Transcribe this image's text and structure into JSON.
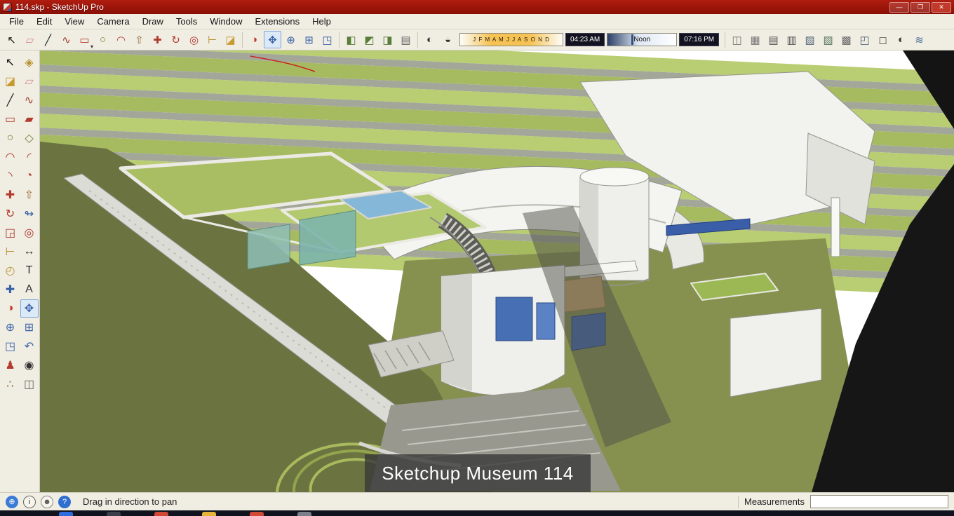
{
  "window": {
    "title": "114.skp - SketchUp Pro",
    "controls": [
      {
        "name": "minimize-button",
        "glyph": "—",
        "style": "background:rgba(255,255,255,.14)"
      },
      {
        "name": "maximize-button",
        "glyph": "❐",
        "style": "background:rgba(255,255,255,.14)"
      },
      {
        "name": "close-button",
        "glyph": "✕",
        "style": "background:#c0392b"
      }
    ]
  },
  "menu": {
    "items": [
      "File",
      "Edit",
      "View",
      "Camera",
      "Draw",
      "Tools",
      "Window",
      "Extensions",
      "Help"
    ]
  },
  "toolbar": {
    "draw_tools": [
      {
        "name": "select-tool",
        "glyph": "↖",
        "style": "color:#111"
      },
      {
        "name": "eraser-tool",
        "glyph": "▱",
        "style": "color:#d98c8c"
      },
      {
        "name": "line-tool",
        "glyph": "╱",
        "style": "color:#222"
      },
      {
        "name": "freehand-tool",
        "glyph": "∿",
        "style": "color:#a33b2e"
      },
      {
        "name": "rectangle-tool",
        "glyph": "▭",
        "style": "color:#b23b2e",
        "caret": true
      },
      {
        "name": "circle-tool",
        "glyph": "○",
        "style": "color:#6f7d2e"
      },
      {
        "name": "arc-tool",
        "glyph": "◠",
        "style": "color:#b23b2e"
      },
      {
        "name": "push-pull-tool",
        "glyph": "⇧",
        "style": "color:#9c6b38"
      },
      {
        "name": "move-tool",
        "glyph": "✚",
        "style": "color:#b23b2e"
      },
      {
        "name": "rotate-tool",
        "glyph": "↻",
        "style": "color:#b23b2e"
      },
      {
        "name": "offset-tool",
        "glyph": "◎",
        "style": "color:#b23b2e"
      },
      {
        "name": "tape-measure-tool",
        "glyph": "⊢",
        "style": "color:#b8912f"
      },
      {
        "name": "paint-bucket-tool",
        "glyph": "◪",
        "style": "color:#c79a2e"
      }
    ],
    "camera_tools": [
      {
        "name": "orbit-tool",
        "glyph": "◑",
        "style": "color:#c0392b"
      },
      {
        "name": "pan-tool",
        "glyph": "✥",
        "style": "color:#3a62a8",
        "pressed": true
      },
      {
        "name": "zoom-tool",
        "glyph": "⊕",
        "style": "color:#3a62a8"
      },
      {
        "name": "zoom-window-tool",
        "glyph": "⊞",
        "style": "color:#3a62a8"
      },
      {
        "name": "zoom-extents-tool",
        "glyph": "◳",
        "style": "color:#3a62a8"
      }
    ],
    "view_tools": [
      {
        "name": "iso-view",
        "glyph": "◧",
        "style": "color:#5a7d3a"
      },
      {
        "name": "top-view",
        "glyph": "◩",
        "style": "color:#5a7d3a"
      },
      {
        "name": "front-view",
        "glyph": "◨",
        "style": "color:#5a7d3a"
      },
      {
        "name": "styles-button",
        "glyph": "▤",
        "style": "color:#666"
      }
    ],
    "shadow_toggles": [
      {
        "name": "shadow-settings-button",
        "glyph": "◐",
        "style": "color:#333"
      },
      {
        "name": "shadow-toggle-button",
        "glyph": "◒",
        "style": "color:#333"
      }
    ],
    "shadow": {
      "months": "J F M A M J J A S O N D",
      "start": "04:23 AM",
      "noon": "Noon",
      "end": "07:16 PM"
    },
    "right_tools": [
      {
        "name": "section-plane-button",
        "glyph": "◫",
        "style": "color:#777"
      },
      {
        "name": "section-cuts-button",
        "glyph": "▦",
        "style": "color:#777"
      },
      {
        "name": "wireframe-style",
        "glyph": "▤",
        "style": "color:#555"
      },
      {
        "name": "hidden-line-style",
        "glyph": "▥",
        "style": "color:#555"
      },
      {
        "name": "shaded-style",
        "glyph": "▧",
        "style": "color:#55677a"
      },
      {
        "name": "shaded-textures-style",
        "glyph": "▨",
        "style": "color:#57755a"
      },
      {
        "name": "monochrome-style",
        "glyph": "▩",
        "style": "color:#666"
      },
      {
        "name": "xray-style",
        "glyph": "◰",
        "style": "color:#55677a"
      },
      {
        "name": "scenes-button",
        "glyph": "◻",
        "style": "color:#555"
      },
      {
        "name": "shadows-dialog-button",
        "glyph": "◐",
        "style": "color:#333"
      },
      {
        "name": "fog-button",
        "glyph": "≋",
        "style": "color:#557799"
      }
    ]
  },
  "left_toolbar": {
    "tools": [
      {
        "name": "select-tool",
        "glyph": "↖",
        "style": "color:#111"
      },
      {
        "name": "make-component-tool",
        "glyph": "◈",
        "style": "color:#b8912f"
      },
      {
        "name": "paint-bucket-tool",
        "glyph": "◪",
        "style": "color:#c79a2e"
      },
      {
        "name": "eraser-tool",
        "glyph": "▱",
        "style": "color:#d98c8c"
      },
      {
        "name": "line-tool",
        "glyph": "╱",
        "style": "color:#222"
      },
      {
        "name": "freehand-tool",
        "glyph": "∿",
        "style": "color:#a33b2e"
      },
      {
        "name": "rectangle-tool",
        "glyph": "▭",
        "style": "color:#b23b2e"
      },
      {
        "name": "rotated-rectangle-tool",
        "glyph": "▰",
        "style": "color:#b23b2e"
      },
      {
        "name": "circle-tool",
        "glyph": "○",
        "style": "color:#6f7d2e"
      },
      {
        "name": "polygon-tool",
        "glyph": "◇",
        "style": "color:#6f7d2e"
      },
      {
        "name": "arc-tool",
        "glyph": "◠",
        "style": "color:#b23b2e"
      },
      {
        "name": "two-point-arc-tool",
        "glyph": "◜",
        "style": "color:#b23b2e"
      },
      {
        "name": "three-point-arc-tool",
        "glyph": "◝",
        "style": "color:#b23b2e"
      },
      {
        "name": "pie-tool",
        "glyph": "◔",
        "style": "color:#b23b2e"
      },
      {
        "name": "move-tool",
        "glyph": "✚",
        "style": "color:#b23b2e"
      },
      {
        "name": "push-pull-tool",
        "glyph": "⇧",
        "style": "color:#9c6b38"
      },
      {
        "name": "rotate-tool",
        "glyph": "↻",
        "style": "color:#b23b2e"
      },
      {
        "name": "follow-me-tool",
        "glyph": "↬",
        "style": "color:#3a62a8"
      },
      {
        "name": "scale-tool",
        "glyph": "◲",
        "style": "color:#b23b2e"
      },
      {
        "name": "offset-tool",
        "glyph": "◎",
        "style": "color:#b23b2e"
      },
      {
        "name": "tape-measure-tool",
        "glyph": "⊢",
        "style": "color:#b8912f"
      },
      {
        "name": "dimension-tool",
        "glyph": "↔",
        "style": "color:#333"
      },
      {
        "name": "protractor-tool",
        "glyph": "◴",
        "style": "color:#b8912f"
      },
      {
        "name": "text-tool",
        "glyph": "T",
        "style": "color:#333"
      },
      {
        "name": "axes-tool",
        "glyph": "✚",
        "style": "color:#3a62a8"
      },
      {
        "name": "three-d-text-tool",
        "glyph": "A",
        "style": "color:#333"
      },
      {
        "name": "orbit-tool",
        "glyph": "◑",
        "style": "color:#c0392b"
      },
      {
        "name": "pan-tool",
        "glyph": "✥",
        "style": "color:#3a62a8",
        "pressed": true
      },
      {
        "name": "zoom-tool",
        "glyph": "⊕",
        "style": "color:#3a62a8"
      },
      {
        "name": "zoom-window-tool",
        "glyph": "⊞",
        "style": "color:#3a62a8"
      },
      {
        "name": "zoom-extents-tool",
        "glyph": "◳",
        "style": "color:#3a62a8"
      },
      {
        "name": "previous-view-tool",
        "glyph": "↶",
        "style": "color:#3a62a8"
      },
      {
        "name": "position-camera-tool",
        "glyph": "♟",
        "style": "color:#b23b2e"
      },
      {
        "name": "look-around-tool",
        "glyph": "◉",
        "style": "color:#333"
      },
      {
        "name": "walk-tool",
        "glyph": "∴",
        "style": "color:#8a5a2a"
      },
      {
        "name": "section-plane-tool",
        "glyph": "◫",
        "style": "color:#666"
      }
    ]
  },
  "viewport": {
    "caption": "Sketchup Museum 114"
  },
  "status_bar": {
    "icons": [
      {
        "name": "geolocation-icon",
        "glyph": "⊕",
        "style": "background:#3a7bd5;color:#fff"
      },
      {
        "name": "info-icon",
        "glyph": "i",
        "style": "background:#f7f5ec;color:#333;border:1px solid #666"
      },
      {
        "name": "user-icon",
        "glyph": "☻",
        "style": "background:#f7f5ec;color:#555;border:1px solid #888"
      },
      {
        "name": "help-icon",
        "glyph": "?",
        "style": "background:#2f6fd0;color:#fff"
      }
    ],
    "hint": "Drag in direction to pan",
    "measurements_label": "Measurements",
    "measurements_value": ""
  },
  "taskbar": {
    "apps": [
      {
        "name": "taskbar-app-icon",
        "style": "background:#2d6cdf"
      },
      {
        "name": "taskbar-app-icon",
        "style": "background:#3b3f4a"
      },
      {
        "name": "taskbar-app-icon",
        "style": "background:#d14836"
      },
      {
        "name": "taskbar-app-icon",
        "style": "background:#e8b339"
      },
      {
        "name": "taskbar-app-icon",
        "style": "background:#d14836"
      },
      {
        "name": "taskbar-app-icon",
        "style": "background:#7a7f8a"
      }
    ]
  },
  "theme": {
    "titlebar_red": "#9b1207",
    "toolbar_bg": "#f0ede3",
    "pressed_blue": "#dce9f7",
    "terrain_green": "#b9cd72",
    "terrain_olive": "#6b7440",
    "window_blue": "#3a5fa8"
  }
}
